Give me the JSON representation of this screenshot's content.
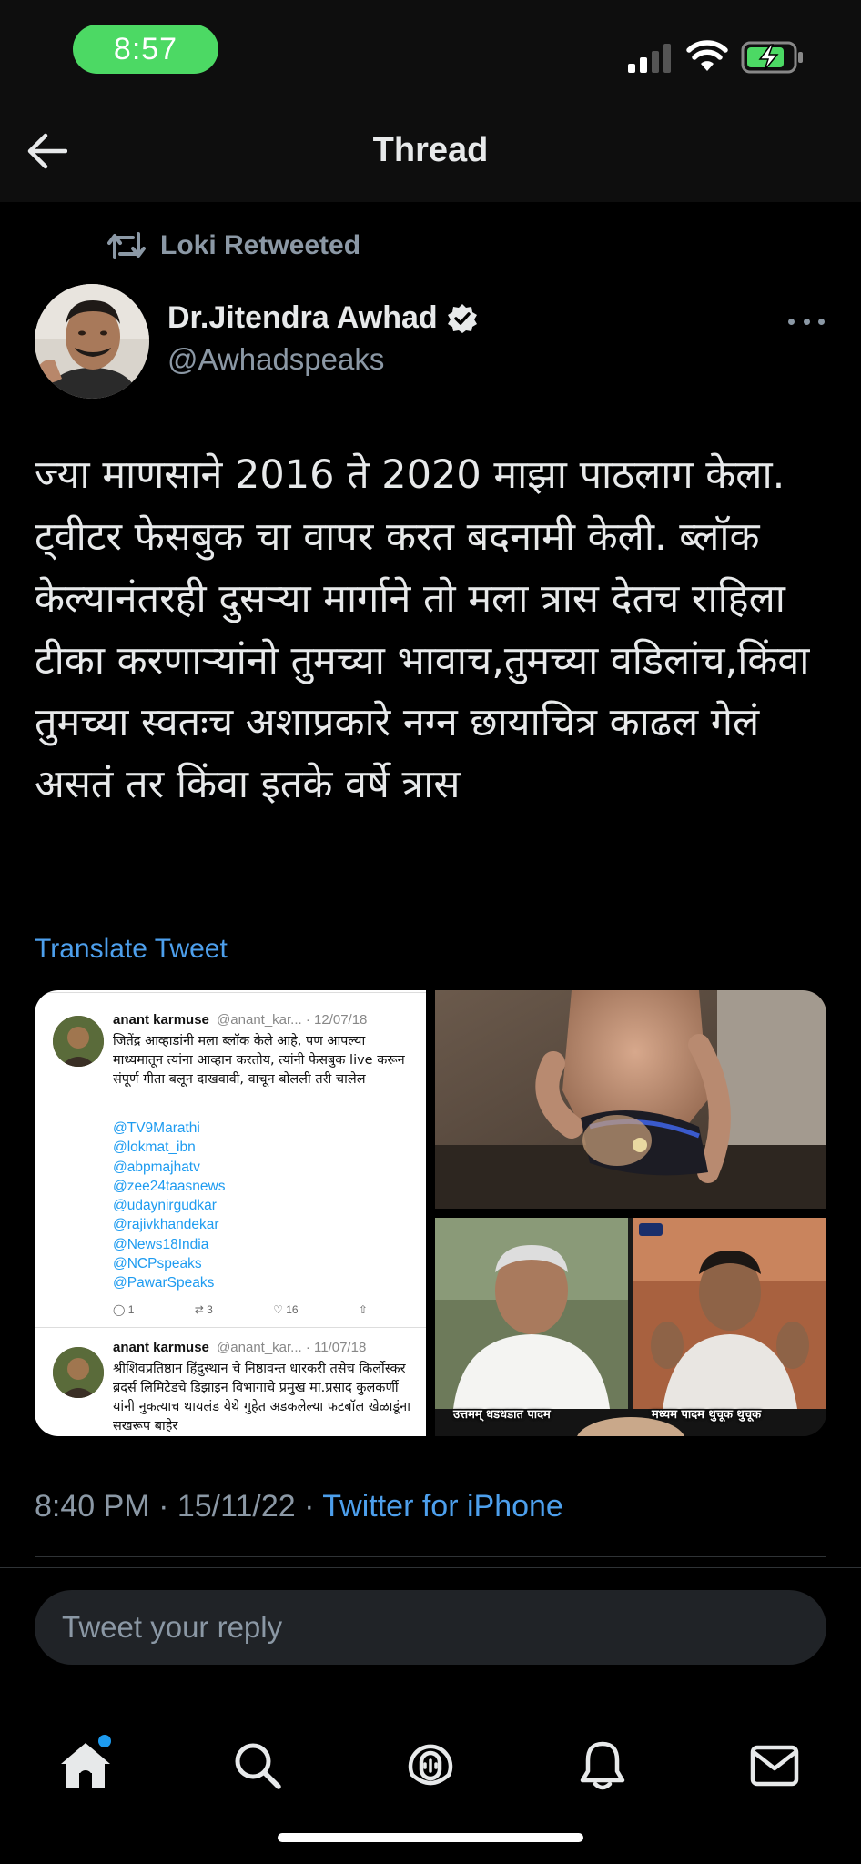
{
  "status_bar": {
    "time": "8:57"
  },
  "header": {
    "title": "Thread"
  },
  "retweet": {
    "label": "Loki Retweeted"
  },
  "author": {
    "name": "Dr.Jitendra Awhad",
    "handle": "@Awhadspeaks"
  },
  "tweet": {
    "text": "ज्या माणसाने 2016 ते 2020 माझा पाठलाग केला. ट्वीटर फेसबुक चा वापर करत बदनामी केली. ब्लॉक केल्यानंतरही दुसऱ्या मार्गाने तो मला त्रास देतच राहिला टीका करणाऱ्यांनो तुमच्या भावाच,तुमच्या वडिलांच,किंवा तुमच्या स्वतःच अशाप्रकारे नग्न छायाचित्र काढल गेलं असतं तर किंवा इतके वर्षे त्रास",
    "translate_label": "Translate Tweet",
    "time": "8:40 PM · 15/11/22 · ",
    "source": "Twitter for iPhone"
  },
  "media": {
    "embedded_tweets": [
      {
        "name": "anant karmuse",
        "handle_date": "@anant_kar... · 12/07/18",
        "body": "जितेंद्र आव्हाडांनी मला ब्लॉक केले आहे, पण आपल्या माध्यमातून त्यांना आव्हान करतोय, त्यांनी फेसबुक live करून संपूर्ण गीता बलून दाखवावी, वाचून बोलली तरी चालेल",
        "mentions": [
          "@TV9Marathi",
          "@lokmat_ibn",
          "@abpmajhatv",
          "@zee24taasnews",
          "@udaynirgudkar",
          "@rajivkhandekar",
          "@News18India",
          "@NCPspeaks",
          "@PawarSpeaks"
        ],
        "replies": "1",
        "retweets": "3",
        "likes": "16"
      },
      {
        "name": "anant karmuse",
        "handle_date": "@anant_kar... · 11/07/18",
        "body": "श्रीशिवप्रतिष्ठान हिंदुस्थान चे निष्ठावन्त धारकरी तसेच किर्लोस्कर ब्रदर्स लिमिटेडचे डिझाइन विभागाचे प्रमुख मा.प्रसाद कुलकर्णी यांनी नुकत्याच थायलंड येथे गुहेत अडकलेल्या फटबॉल खेळाडूंना सखरूप बाहेर"
      }
    ],
    "captions": [
      "उत्तमम् धडधडात पादम",
      "मध्यम पादम थुचूक थुचूक"
    ]
  },
  "reply": {
    "placeholder": "Tweet your reply"
  },
  "tabs": [
    "home-icon",
    "search-icon",
    "spaces-icon",
    "notifications-icon",
    "messages-icon"
  ],
  "colors": {
    "accent": "#1d9bf0",
    "link": "#4d9fec",
    "status_time_pill": "#4cd964",
    "muted_text": "#8b98a5"
  }
}
